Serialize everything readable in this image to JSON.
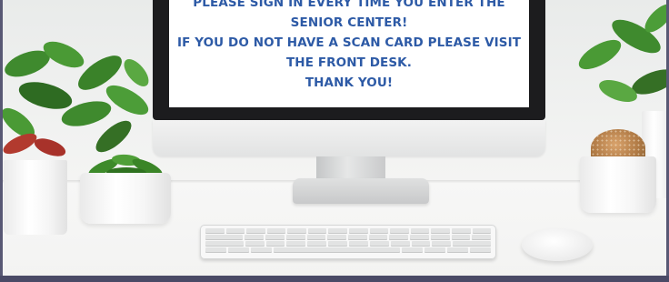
{
  "monitor": {
    "screen_lines": [
      "PLEASE SIGN IN EVERY TIME YOU ENTER THE",
      "SENIOR CENTER!",
      "IF YOU DO NOT HAVE A SCAN CARD PLEASE VISIT",
      "THE FRONT DESK.",
      "THANK YOU!"
    ],
    "text_color": "#2d5aa6"
  },
  "colors": {
    "frame_border": "#4a4a66",
    "leaf_green": "#3f8a2e",
    "leaf_dark": "#2e6b22",
    "leaf_red": "#b23a2e"
  },
  "objects": [
    "imac-monitor",
    "wireless-keyboard",
    "wireless-mouse",
    "potted-plant",
    "succulent-plant",
    "cactus-plant",
    "potted-plant-right"
  ]
}
